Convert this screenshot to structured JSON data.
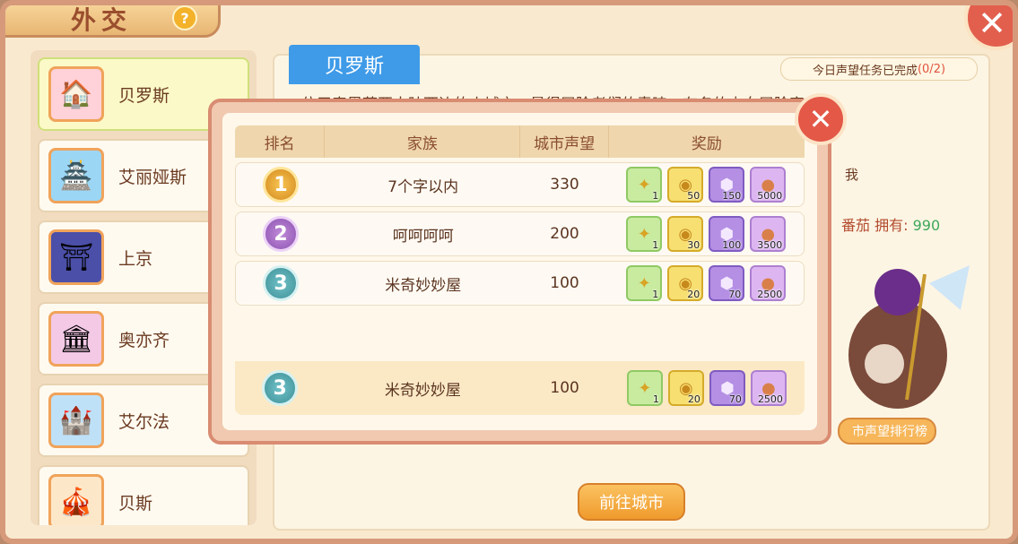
{
  "header": {
    "title": "外交",
    "help_icon": "question-icon"
  },
  "sidebar": {
    "items": [
      {
        "label": "贝罗斯",
        "icon": "🏠",
        "selected": true
      },
      {
        "label": "艾丽娅斯",
        "icon": "🏯",
        "selected": false
      },
      {
        "label": "上京",
        "icon": "⛩",
        "selected": false
      },
      {
        "label": "奥亦齐",
        "icon": "🏛",
        "selected": false
      },
      {
        "label": "艾尔法",
        "icon": "🏰",
        "selected": false
      },
      {
        "label": "贝斯",
        "icon": "🎪",
        "selected": false
      }
    ]
  },
  "city_panel": {
    "name": "贝罗斯",
    "quest_status": "今日声望任务已完成",
    "quest_progress": "(0/2)",
    "description": "位于泰恩萨亚大陆西边的小城市，最得冒险者们的青睐。有名的少女冒险家",
    "desc_fragment": "我",
    "owned_label": "番茄 拥有:",
    "owned_value": "990",
    "rank_button": "市声望排行榜",
    "goto_button": "前往城市"
  },
  "modal": {
    "columns": {
      "rank": "排名",
      "family": "家族",
      "reputation": "城市声望",
      "reward": "奖励"
    },
    "rows": [
      {
        "rank": "1",
        "family": "7个字以内",
        "reputation": "330",
        "rewards": [
          "1",
          "50",
          "150",
          "5000"
        ]
      },
      {
        "rank": "2",
        "family": "呵呵呵呵",
        "reputation": "200",
        "rewards": [
          "1",
          "30",
          "100",
          "3500"
        ]
      },
      {
        "rank": "3",
        "family": "米奇妙妙屋",
        "reputation": "100",
        "rewards": [
          "1",
          "20",
          "70",
          "2500"
        ]
      }
    ],
    "my_rank": {
      "rank": "3",
      "family": "米奇妙妙屋",
      "reputation": "100",
      "rewards": [
        "1",
        "20",
        "70",
        "2500"
      ]
    }
  },
  "colors": {
    "accent_blue": "#3f9be8",
    "close_red": "#e35847",
    "button_orange": "#ef9a2c"
  }
}
